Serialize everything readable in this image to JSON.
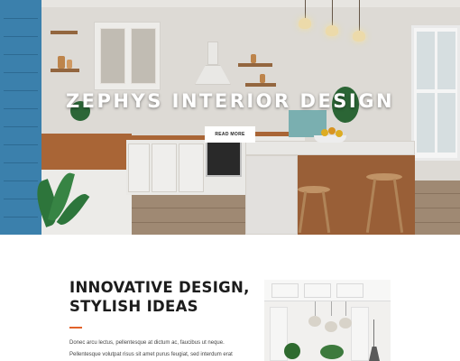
{
  "hero": {
    "title": "ZEPHYS INTERIOR DESIGN",
    "button_label": "READ MORE",
    "image": "kitchen-interior-photo"
  },
  "content": {
    "title_lines": [
      "INNOVATIVE DESIGN,",
      "STYLISH IDEAS"
    ],
    "body_lines": [
      "Donec arcu lectus, pellentesque at dictum ac, faucibus ut neque.",
      "Pellentesque volutpat risus sit amet purus feugiat, sed interdum erat"
    ],
    "image": "interior-room-photo"
  },
  "colors": {
    "accent": "#e2622a",
    "heading": "#1c1c1c",
    "body_text": "#444444",
    "button_bg": "#ffffff"
  }
}
